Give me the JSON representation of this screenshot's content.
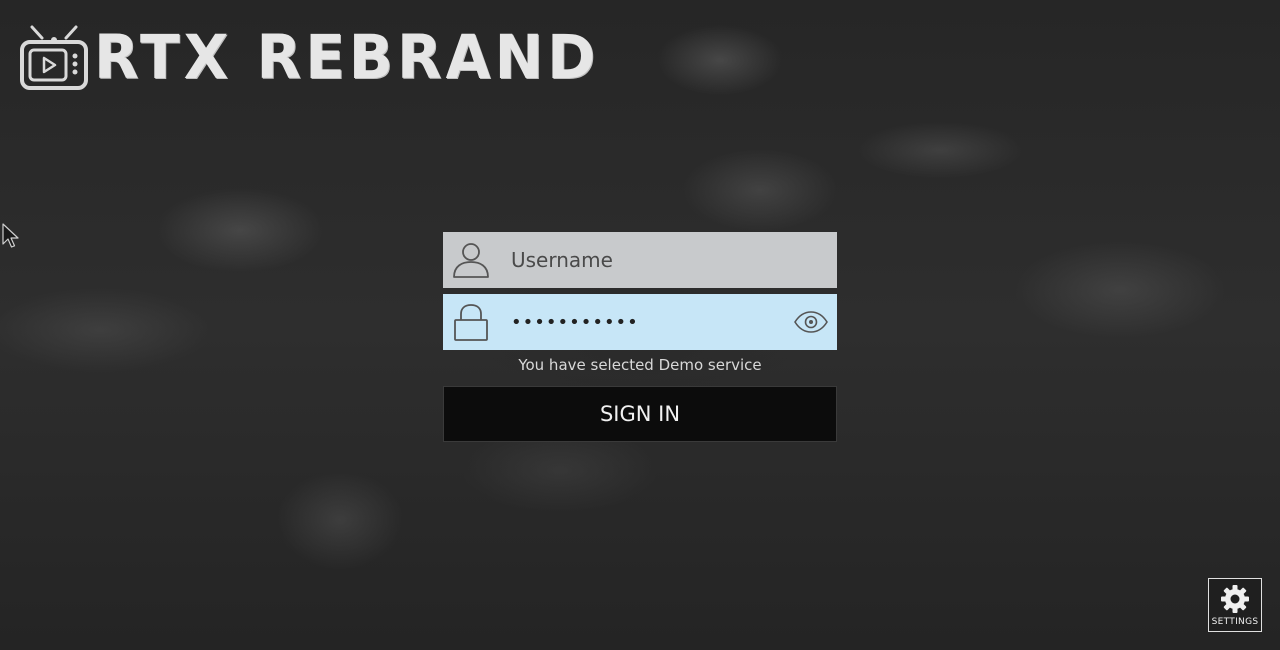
{
  "app": {
    "logo_text": "RTX REBRAND",
    "logo_icon": "tv-play-icon"
  },
  "colors": {
    "username_field_bg": "#c8cacc",
    "password_field_bg": "#c7e6f7",
    "signin_bg": "#0c0c0c",
    "text_light": "#e6e6e6"
  },
  "login": {
    "username": {
      "icon": "user-icon",
      "placeholder": "Username",
      "value": ""
    },
    "password": {
      "icon": "lock-icon",
      "value": "•••••••••••",
      "toggle_icon": "eye-icon"
    },
    "service_note": "You have selected Demo service",
    "signin_label": "SIGN IN"
  },
  "settings": {
    "icon": "gear-icon",
    "label": "SETTINGS"
  }
}
